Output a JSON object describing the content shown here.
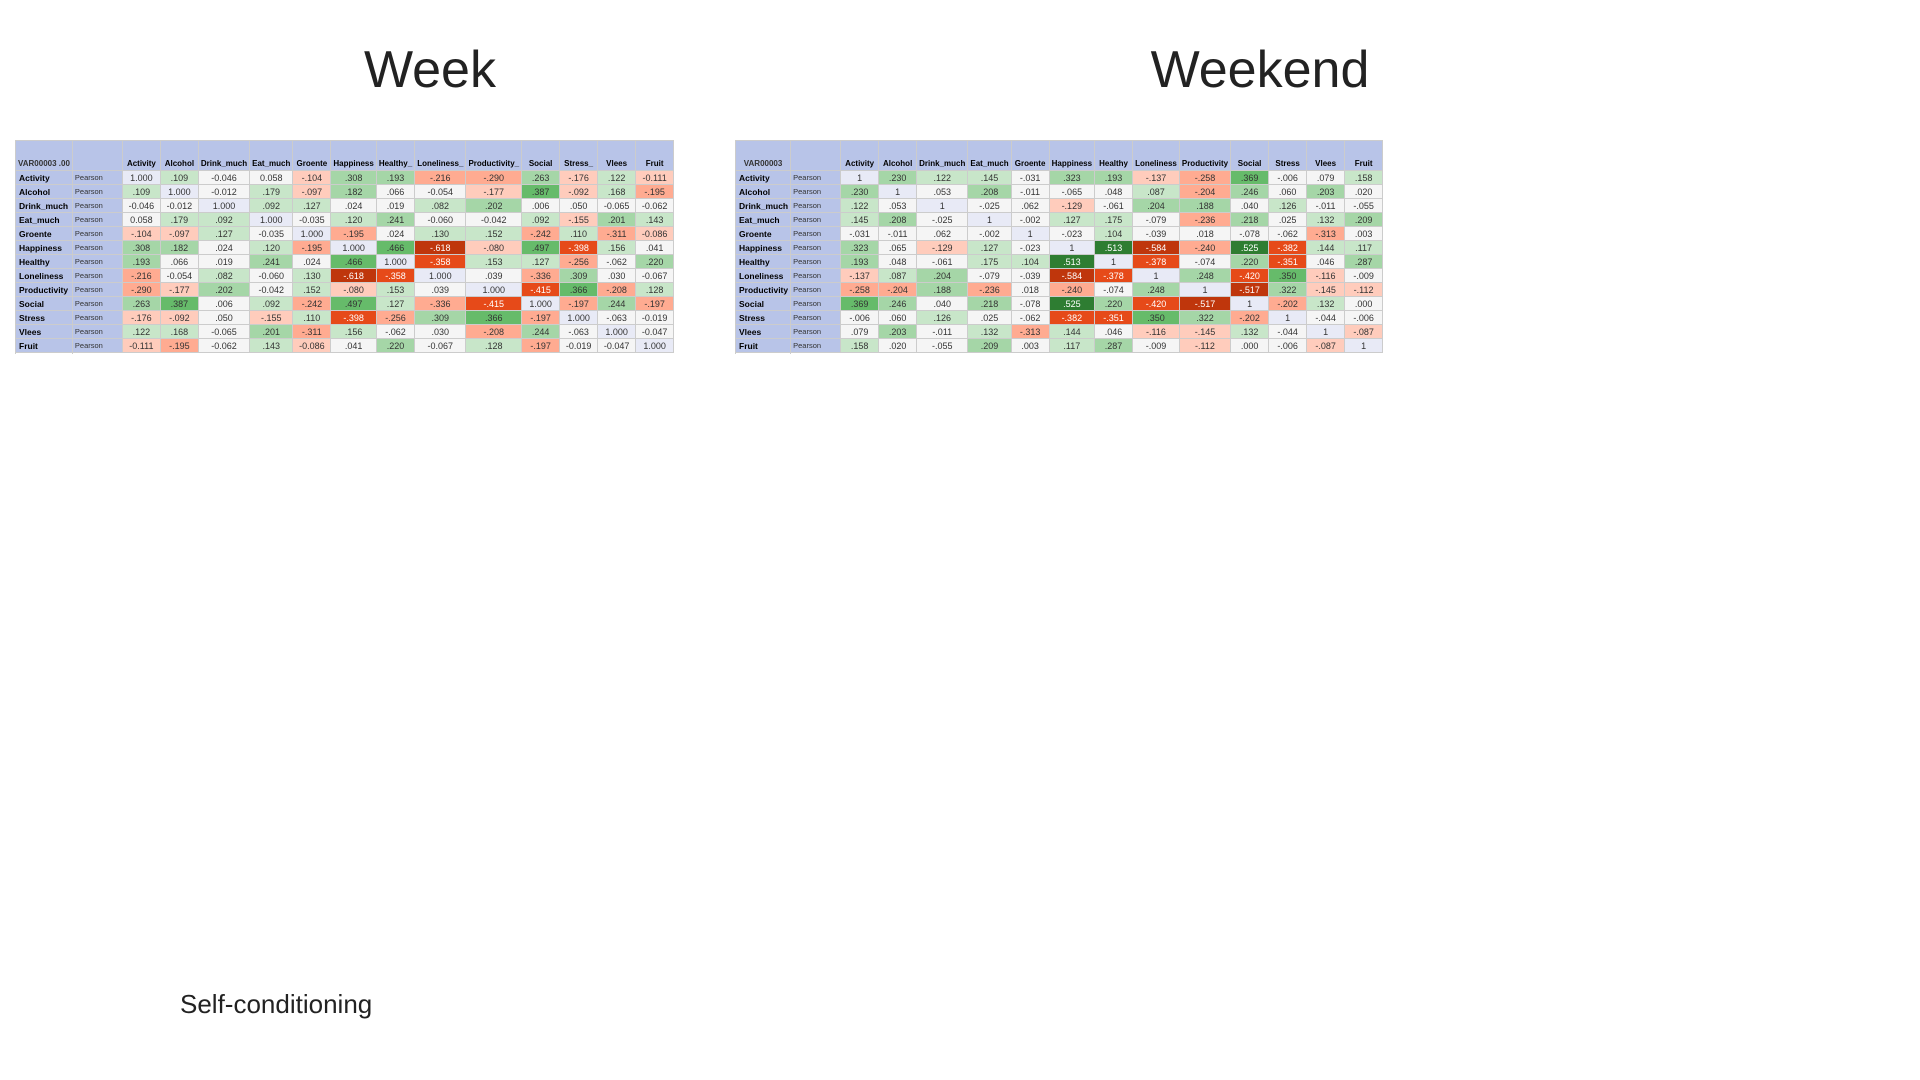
{
  "titles": {
    "week": "Week",
    "weekend": "Weekend",
    "self_conditioning": "Self-conditioning"
  },
  "week_table": {
    "columns": [
      "VAR00003\n.00",
      "Activity",
      "Alcohol",
      "Drink_much",
      "Eat_much",
      "Groente",
      "Happiness",
      "Healthy_",
      "Loneliness_",
      "Productivity_",
      "Social",
      "Stress_",
      "Vlees",
      "Fruit"
    ],
    "rows": [
      {
        "var": "Activity",
        "sub": "Pearson\nCorrelation",
        "vals": [
          "1.000",
          ".109",
          "-0.046",
          "0.058",
          "-.104",
          ".308",
          ".193",
          "-.216",
          "-.290",
          ".263",
          "-.176",
          ".122",
          "-0.111"
        ]
      },
      {
        "var": "Alcohol",
        "sub": "Pearson\nCorrelation",
        "vals": [
          ".109",
          "1.000",
          "-0.012",
          ".179",
          "-.097",
          ".182",
          ".066",
          "-0.054",
          "-.177",
          ".387",
          "-.092",
          ".168",
          "-.195"
        ]
      },
      {
        "var": "Drink_much",
        "sub": "Pearson\nCorrelation",
        "vals": [
          "-0.046",
          "-0.012",
          "1.000",
          ".092",
          ".127",
          ".024",
          ".019",
          ".082",
          ".202",
          ".006",
          ".050",
          "-0.065",
          "-0.062"
        ]
      },
      {
        "var": "Eat_much",
        "sub": "Pearson\nCorrelation",
        "vals": [
          "0.058",
          ".179",
          ".092",
          "1.000",
          "-0.035",
          ".120",
          ".241",
          "-0.060",
          "-0.042",
          ".092",
          "-.155",
          ".201",
          ".143"
        ]
      },
      {
        "var": "Groente",
        "sub": "Pearson\nCorrelation",
        "vals": [
          "-.104",
          "-.097",
          ".127",
          "-0.035",
          "1.000",
          "-.195",
          ".024",
          ".130",
          ".152",
          "-.242",
          ".110",
          "-.311",
          "-0.086"
        ]
      },
      {
        "var": "Happiness",
        "sub": "Pearson\nCorrelation",
        "vals": [
          ".308",
          ".182",
          ".024",
          ".120",
          "-.195",
          "1.000",
          ".466",
          "-.618",
          "-.080",
          ".497",
          "-.398",
          ".156",
          ".041"
        ]
      },
      {
        "var": "Healthy",
        "sub": "Pearson\nCorrelation",
        "vals": [
          ".193",
          ".066",
          ".019",
          ".241",
          ".024",
          ".466",
          "1.000",
          "-.358",
          ".153",
          ".127",
          "-.256",
          "-.062",
          ".220"
        ]
      },
      {
        "var": "Loneliness",
        "sub": "Pearson\nCorrelation",
        "vals": [
          "-.216",
          "-0.054",
          ".082",
          "-0.060",
          ".130",
          "-.618",
          "-.358",
          "1.000",
          ".039",
          "-.336",
          ".309",
          ".030",
          "-0.067"
        ]
      },
      {
        "var": "Productivity",
        "sub": "Pearson\nCorrelation",
        "vals": [
          "-.290",
          "-.177",
          ".202",
          "-0.042",
          ".152",
          "-.080",
          ".153",
          ".039",
          "1.000",
          "-.415",
          ".366",
          "-.208",
          ".128"
        ]
      },
      {
        "var": "Social",
        "sub": "Pearson\nCorrelation",
        "vals": [
          ".263",
          ".387",
          ".006",
          ".092",
          "-.242",
          ".497",
          ".127",
          "-.336",
          "-.415",
          "1.000",
          "-.197",
          ".244",
          "-.197"
        ]
      },
      {
        "var": "Stress",
        "sub": "Pearson\nCorrelation",
        "vals": [
          "-.176",
          "-.092",
          ".050",
          "-.155",
          ".110",
          "-.398",
          "-.256",
          ".309",
          ".366",
          "-.197",
          "1.000",
          "-.063",
          "-0.019"
        ]
      },
      {
        "var": "Vlees",
        "sub": "Pearson\nCorrelation",
        "vals": [
          ".122",
          ".168",
          "-0.065",
          ".201",
          "-.311",
          ".156",
          "-.062",
          ".030",
          "-.208",
          ".244",
          "-.063",
          "1.000",
          "-0.047"
        ]
      },
      {
        "var": "Fruit",
        "sub": "Pearson\nCorrelation",
        "vals": [
          "-0.111",
          "-.195",
          "-0.062",
          ".143",
          "-0.086",
          ".041",
          ".220",
          "-0.067",
          ".128",
          "-.197",
          "-0.019",
          "-0.047",
          "1.000"
        ]
      }
    ]
  },
  "weekend_table": {
    "columns": [
      "VAR00003",
      "Activity",
      "Alcohol",
      "Drink_much",
      "Eat_much",
      "Groente",
      "Happiness",
      "Healthy",
      "Loneliness",
      "Productivity",
      "Social",
      "Stress",
      "Vlees",
      "Fruit"
    ],
    "rows": [
      {
        "var": "Activity",
        "sub": "Pearson\nCorrelation",
        "vals": [
          "1",
          ".230",
          ".122",
          ".145",
          "-.031",
          ".323",
          ".193",
          "-.137",
          "-.258",
          ".369",
          "-.006",
          ".079",
          ".158"
        ]
      },
      {
        "var": "Alcohol",
        "sub": "Pearson\nCorrelation",
        "vals": [
          ".230",
          "1",
          ".053",
          ".208",
          "-.011",
          "-.065",
          ".048",
          ".087",
          "-.204",
          ".246",
          ".060",
          ".203",
          ".020"
        ]
      },
      {
        "var": "Drink_much",
        "sub": "Pearson\nCorrelation",
        "vals": [
          ".122",
          ".053",
          "1",
          "-.025",
          ".062",
          "-.129",
          "-.061",
          ".204",
          ".188",
          ".040",
          ".126",
          "-.011",
          "-.055"
        ]
      },
      {
        "var": "Eat_much",
        "sub": "Pearson\nCorrelation",
        "vals": [
          ".145",
          ".208",
          "-.025",
          "1",
          "-.002",
          ".127",
          ".175",
          "-.079",
          "-.236",
          ".218",
          ".025",
          ".132",
          ".209"
        ]
      },
      {
        "var": "Groente",
        "sub": "Pearson\nCorrelation",
        "vals": [
          "-.031",
          "-.011",
          ".062",
          "-.002",
          "1",
          "-.023",
          ".104",
          "-.039",
          ".018",
          "-.078",
          "-.062",
          "-.313",
          ".003"
        ]
      },
      {
        "var": "Happiness",
        "sub": "Pearson\nCorrelation",
        "vals": [
          ".323",
          ".065",
          "-.129",
          ".127",
          "-.023",
          "1",
          ".513",
          "-.584",
          "-.240",
          ".525",
          "-.382",
          ".144",
          ".117"
        ]
      },
      {
        "var": "Healthy",
        "sub": "Pearson\nCorrelation",
        "vals": [
          ".193",
          ".048",
          "-.061",
          ".175",
          ".104",
          ".513",
          "1",
          "-.378",
          "-.074",
          ".220",
          "-.351",
          ".046",
          ".287"
        ]
      },
      {
        "var": "Loneliness",
        "sub": "Pearson\nCorrelation",
        "vals": [
          "-.137",
          ".087",
          ".204",
          "-.079",
          "-.039",
          "-.584",
          "-.378",
          "1",
          ".248",
          "-.420",
          ".350",
          "-.116",
          "-.009"
        ]
      },
      {
        "var": "Productivity",
        "sub": "Pearson\nCorrelation",
        "vals": [
          "-.258",
          "-.204",
          ".188",
          "-.236",
          ".018",
          "-.240",
          "-.074",
          ".248",
          "1",
          "-.517",
          ".322",
          "-.145",
          "-.112"
        ]
      },
      {
        "var": "Social",
        "sub": "Pearson\nCorrelation",
        "vals": [
          ".369",
          ".246",
          ".040",
          ".218",
          "-.078",
          ".525",
          ".220",
          "-.420",
          "-.517",
          "1",
          "-.202",
          ".132",
          ".000"
        ]
      },
      {
        "var": "Stress",
        "sub": "Pearson\nCorrelation",
        "vals": [
          "-.006",
          ".060",
          ".126",
          ".025",
          "-.062",
          "-.382",
          "-.351",
          ".350",
          ".322",
          "-.202",
          "1",
          "-.044",
          "-.006"
        ]
      },
      {
        "var": "Vlees",
        "sub": "Pearson\nCorrelation",
        "vals": [
          ".079",
          ".203",
          "-.011",
          ".132",
          "-.313",
          ".144",
          ".046",
          "-.116",
          "-.145",
          ".132",
          "-.044",
          "1",
          "-.087"
        ]
      },
      {
        "var": "Fruit",
        "sub": "Pearson\nCorrelation",
        "vals": [
          ".158",
          ".020",
          "-.055",
          ".209",
          ".003",
          ".117",
          ".287",
          "-.009",
          "-.112",
          ".000",
          "-.006",
          "-.087",
          "1"
        ]
      }
    ]
  }
}
